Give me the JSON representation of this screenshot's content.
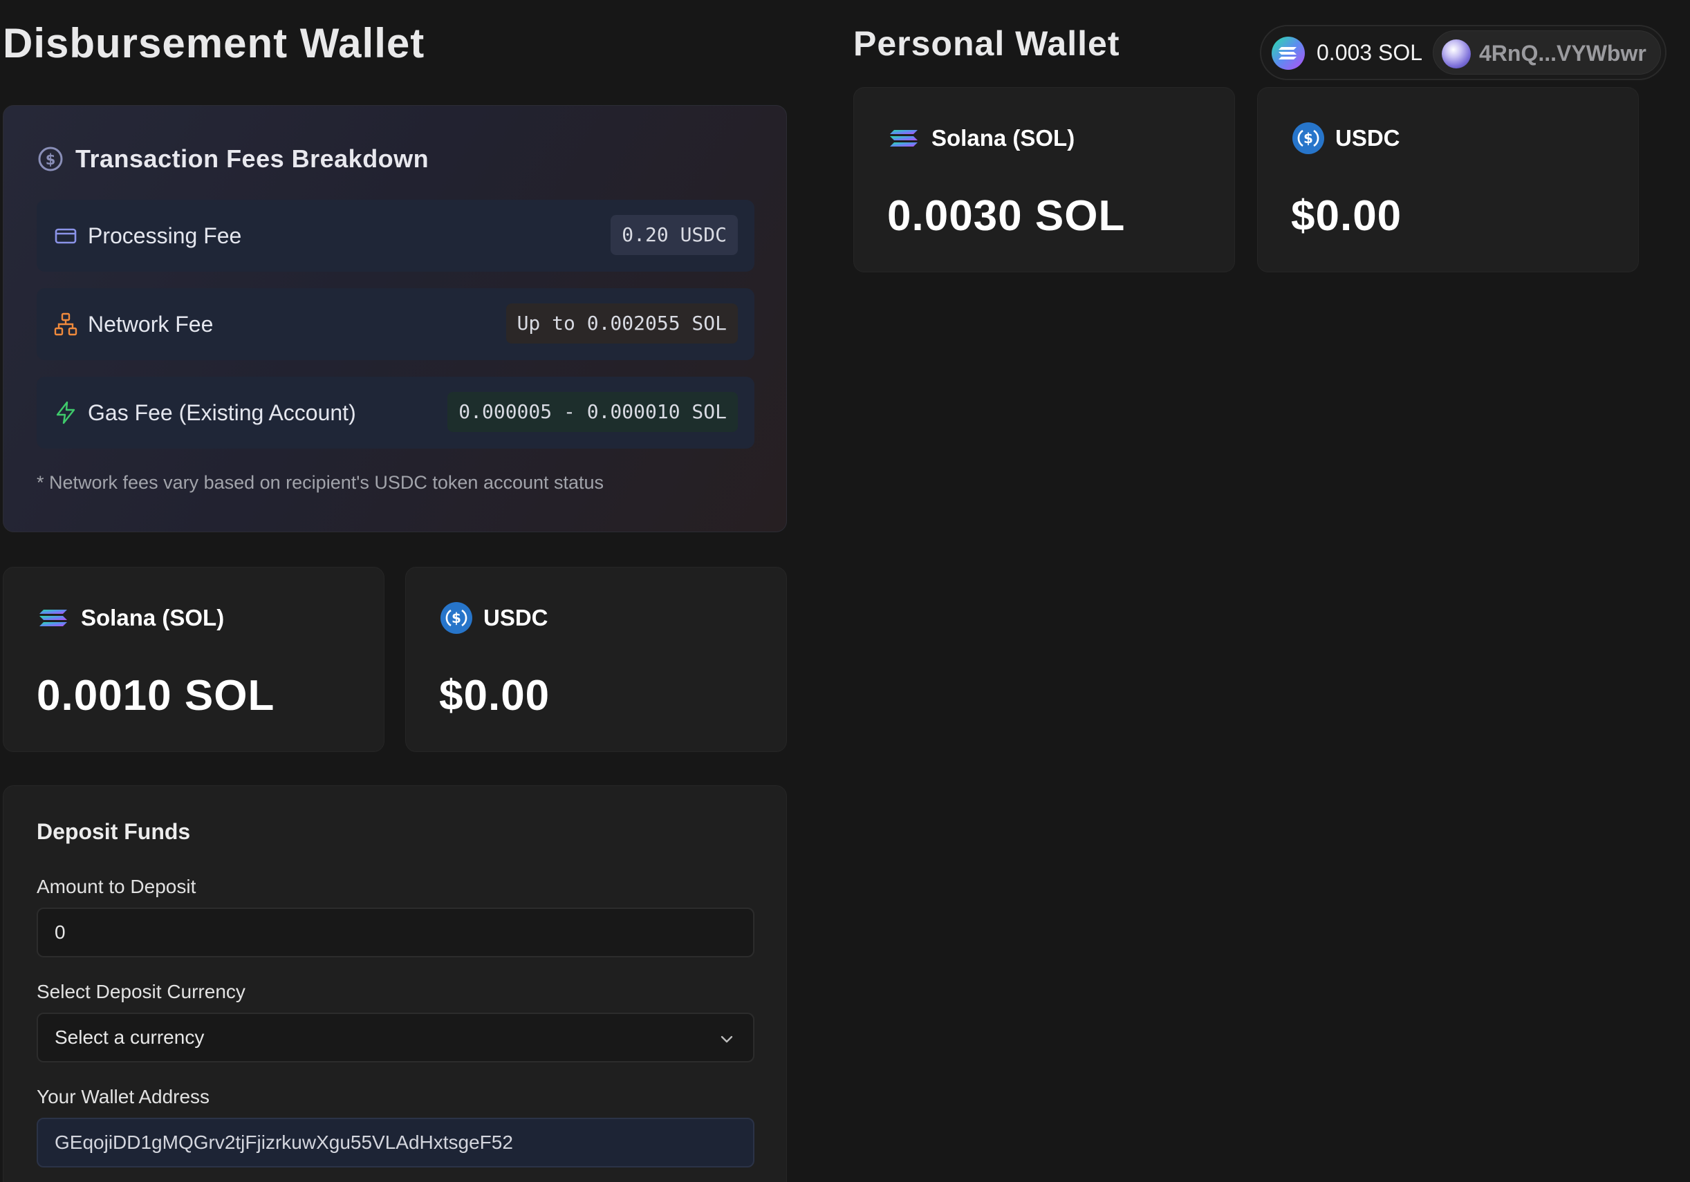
{
  "disbursement": {
    "title": "Disbursement Wallet",
    "fees": {
      "title": "Transaction Fees Breakdown",
      "rows": [
        {
          "label": "Processing Fee",
          "value": "0.20 USDC",
          "icon": "credit-card-icon",
          "icon_color": "#8b93e8"
        },
        {
          "label": "Network Fee",
          "value": "Up to 0.002055 SOL",
          "icon": "network-icon",
          "icon_color": "#f08a3c"
        },
        {
          "label": "Gas Fee (Existing Account)",
          "value": "0.000005 - 0.000010 SOL",
          "icon": "lightning-icon",
          "icon_color": "#3fca6b"
        }
      ],
      "note": "* Network fees vary based on recipient's USDC token account status"
    },
    "tokens": [
      {
        "name": "Solana (SOL)",
        "value": "0.0010 SOL",
        "icon": "solana-icon"
      },
      {
        "name": "USDC",
        "value": "$0.00",
        "icon": "usdc-icon"
      }
    ],
    "deposit": {
      "title": "Deposit Funds",
      "amount_label": "Amount to Deposit",
      "amount_value": "0",
      "currency_label": "Select Deposit Currency",
      "currency_value": "Select a currency",
      "address_label": "Your Wallet Address",
      "address_value": "GEqojiDD1gMQGrv2tjFjizrkuwXgu55VLAdHxtsgeF52"
    }
  },
  "personal": {
    "title": "Personal Wallet",
    "tokens": [
      {
        "name": "Solana (SOL)",
        "value": "0.0030 SOL",
        "icon": "solana-icon"
      },
      {
        "name": "USDC",
        "value": "$0.00",
        "icon": "usdc-icon"
      }
    ]
  },
  "wallet_button": {
    "balance": "0.003 SOL",
    "address": "4RnQ...VYWbwr"
  },
  "colors": {
    "background": "#171717",
    "card": "#1f1f1f",
    "fee_row": "#1f2637",
    "usdc_blue": "#2775ca"
  }
}
